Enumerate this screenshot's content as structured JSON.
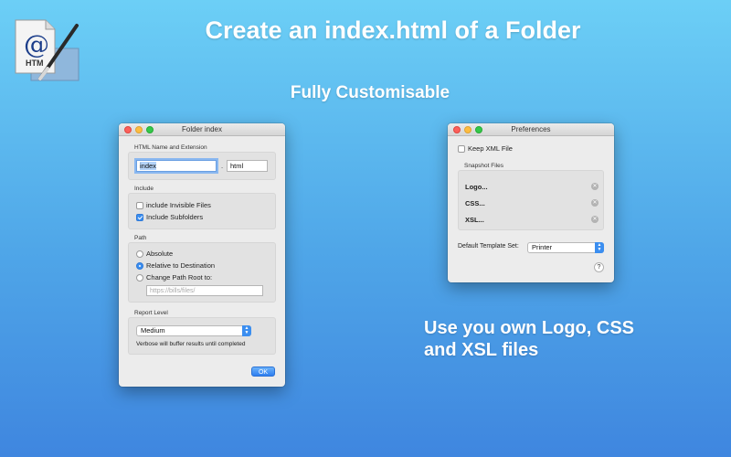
{
  "hero": {
    "title": "Create an index.html of a Folder",
    "subtitle": "Fully Customisable",
    "caption_line1": "Use you own Logo, CSS",
    "caption_line2": "and XSL files"
  },
  "app_icon": {
    "label": "HTM",
    "symbol": "@"
  },
  "folder_index_window": {
    "title": "Folder index",
    "html_section": {
      "label": "HTML Name and Extension",
      "name_value": "index",
      "separator": ".",
      "extension_value": "html"
    },
    "include_section": {
      "label": "Include",
      "options": [
        {
          "label": "include Invisible Files",
          "checked": false
        },
        {
          "label": "Include Subfolders",
          "checked": true
        }
      ]
    },
    "path_section": {
      "label": "Path",
      "options": [
        {
          "label": "Absolute",
          "checked": false
        },
        {
          "label": "Relative to Destination",
          "checked": true
        },
        {
          "label": "Change Path Root to:",
          "checked": false
        }
      ],
      "root_placeholder": "https://bills/files/"
    },
    "report_section": {
      "label": "Report Level",
      "selected": "Medium",
      "note": "Verbose will buffer results until completed"
    },
    "ok_label": "OK"
  },
  "preferences_window": {
    "title": "Preferences",
    "keep_xml": {
      "label": "Keep XML File",
      "checked": false
    },
    "snapshot_label": "Snapshot Files",
    "snapshot_items": [
      {
        "label": "Logo..."
      },
      {
        "label": "CSS..."
      },
      {
        "label": "XSL..."
      }
    ],
    "template_label": "Default Template Set:",
    "template_selected": "Printer",
    "help_label": "?"
  },
  "colors": {
    "accent": "#3b8ef0",
    "background_top": "#6ccff6",
    "background_bottom": "#3f86df"
  }
}
